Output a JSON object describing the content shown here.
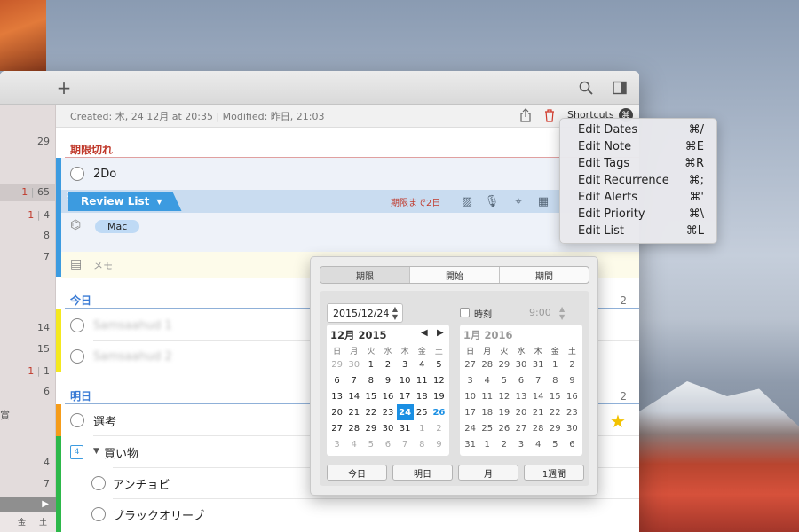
{
  "toolbar": {
    "add_icon": "plus-icon",
    "search_icon": "search-icon",
    "panel_icon": "sidebar-toggle-icon"
  },
  "sidebar": {
    "numbers": [
      {
        "text": "29",
        "red": "",
        "top": 0
      },
      {
        "text": "65",
        "red": "1",
        "sep": "|"
      },
      {
        "text": "4",
        "red": "1",
        "sep": "|"
      },
      {
        "text": "8"
      },
      {
        "text": "7"
      },
      {
        "text": "14"
      },
      {
        "text": "15"
      },
      {
        "text": "1",
        "red": "1",
        "sep": "|"
      },
      {
        "text": "6"
      },
      {
        "text": "4"
      },
      {
        "text": "7"
      }
    ],
    "side_label": "賞",
    "bottom_arrow": "▶",
    "weekdays": [
      "金",
      "土"
    ]
  },
  "infobar": {
    "meta": "Created: 木, 24 12月 at 20:35  |  Modified: 昨日, 21:03",
    "shortcuts_label": "Shortcuts",
    "shortcuts_key": "⌘"
  },
  "sections": {
    "overdue": "期限切れ",
    "today": "今日",
    "today_count": "2",
    "tomorrow": "明日",
    "tomorrow_count": "2"
  },
  "tasks": {
    "twodo": "2Do",
    "review_list": "Review List",
    "review_due": "期限まで2日",
    "mac_tag": "Mac",
    "memo_placeholder": "メモ",
    "blur1": "Samsaahud 1",
    "blur2": "Samsaahud 2",
    "senkou": "選考",
    "shopping": "買い物",
    "shopping_badge": "4",
    "anchovy": "アンチョビ",
    "olive": "ブラックオリーブ"
  },
  "shortcuts_menu": [
    {
      "label": "Edit Dates",
      "key": "⌘/"
    },
    {
      "label": "Edit Note",
      "key": "⌘E"
    },
    {
      "label": "Edit Tags",
      "key": "⌘R"
    },
    {
      "label": "Edit Recurrence",
      "key": "⌘;"
    },
    {
      "label": "Edit Alerts",
      "key": "⌘'"
    },
    {
      "label": "Edit Priority",
      "key": "⌘\\"
    },
    {
      "label": "Edit List",
      "key": "⌘L"
    }
  ],
  "datepicker": {
    "tabs": [
      "期限",
      "開始",
      "期間"
    ],
    "date_value": "2015/12/24",
    "time_label": "時刻",
    "time_value": "9:00",
    "left_title": "12月 2015",
    "right_title": "1月 2016",
    "dow": [
      "日",
      "月",
      "火",
      "水",
      "木",
      "金",
      "土"
    ],
    "left_days": [
      "29",
      "30",
      "1",
      "2",
      "3",
      "4",
      "5",
      "6",
      "7",
      "8",
      "9",
      "10",
      "11",
      "12",
      "13",
      "14",
      "15",
      "16",
      "17",
      "18",
      "19",
      "20",
      "21",
      "22",
      "23",
      "24",
      "25",
      "26",
      "27",
      "28",
      "29",
      "30",
      "31",
      "1",
      "2",
      "3",
      "4",
      "5",
      "6",
      "7",
      "8",
      "9"
    ],
    "right_days": [
      "27",
      "28",
      "29",
      "30",
      "31",
      "1",
      "2",
      "3",
      "4",
      "5",
      "6",
      "7",
      "8",
      "9",
      "10",
      "11",
      "12",
      "13",
      "14",
      "15",
      "16",
      "17",
      "18",
      "19",
      "20",
      "21",
      "22",
      "23",
      "24",
      "25",
      "26",
      "27",
      "28",
      "29",
      "30",
      "31",
      "1",
      "2",
      "3",
      "4",
      "5",
      "6"
    ],
    "selected_day": "24",
    "quick_buttons": [
      "今日",
      "明日",
      "月",
      "1週間"
    ]
  }
}
